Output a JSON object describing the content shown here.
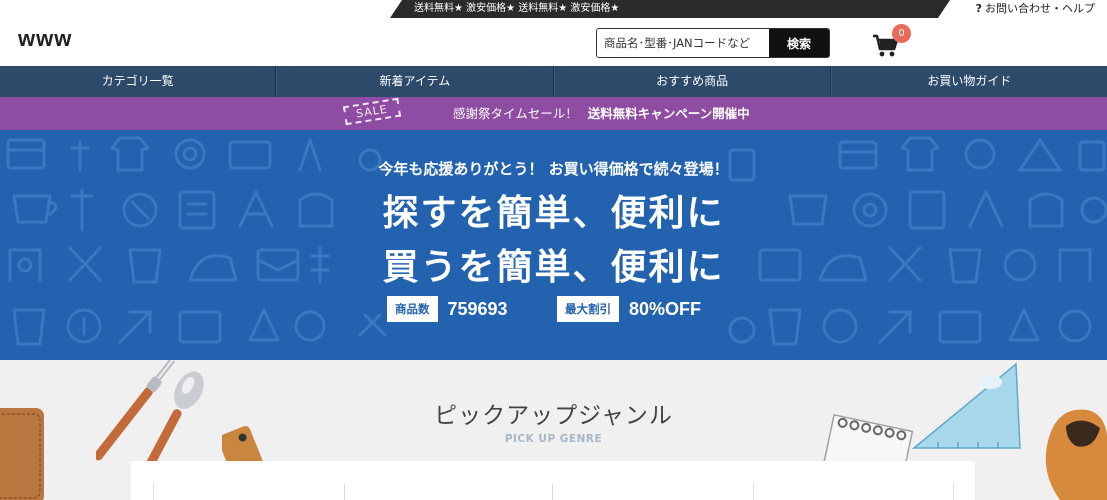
{
  "ticker": {
    "text": "送料無料★ 激安価格★ 送料無料★ 激安価格★"
  },
  "help": {
    "icon": "question-icon",
    "label": "お問い合わせ・ヘルプ"
  },
  "header": {
    "logo": "www",
    "search": {
      "placeholder": "商品名･型番･JANコードなど",
      "button_label": "検索"
    },
    "cart": {
      "icon": "cart-icon",
      "count": "0"
    }
  },
  "nav": {
    "items": [
      {
        "label": "カテゴリ一覧"
      },
      {
        "label": "新着アイテム"
      },
      {
        "label": "おすすめ商品"
      },
      {
        "label": "お買い物ガイド"
      }
    ]
  },
  "sale": {
    "tag": "SALE",
    "text": "感謝祭タイムセール！",
    "strong": "送料無料キャンペーン開催中"
  },
  "hero": {
    "subtitle": "今年も応援ありがとう！ お買い得価格で続々登場！",
    "line1": "探すを簡単、便利に",
    "line2": "買うを簡単、便利に",
    "stats": [
      {
        "label": "商品数",
        "value": "759693"
      },
      {
        "label": "最大割引",
        "value": "80%OFF"
      }
    ]
  },
  "pickup": {
    "title": "ピックアップジャンル",
    "subtitle": "PICK UP GENRE"
  },
  "colors": {
    "nav_bg": "#2d4a6b",
    "sale_bg": "#8e4ca2",
    "hero_bg": "#2262ae",
    "badge": "#e96a5a"
  }
}
